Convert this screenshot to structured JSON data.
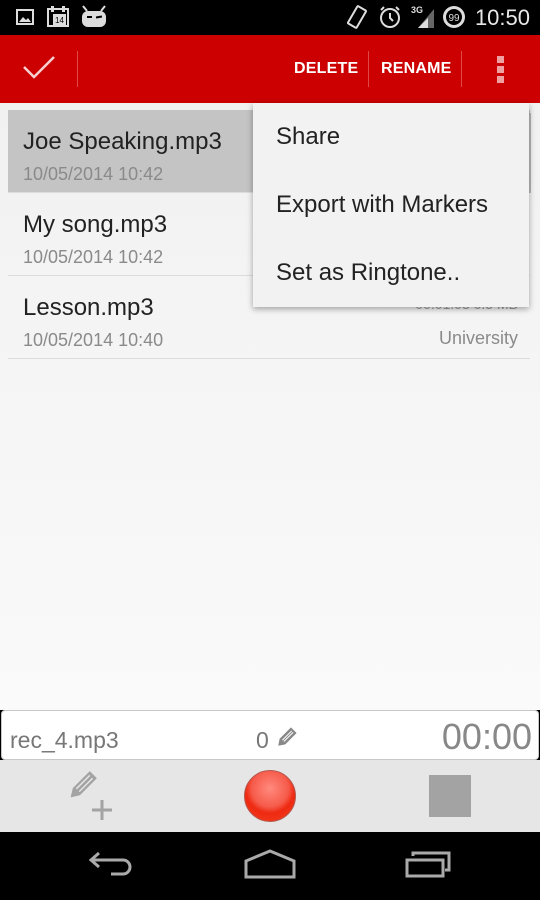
{
  "status_bar": {
    "icons": [
      "image-notification-icon",
      "calendar-notification-icon",
      "cyanogen-mascot-icon",
      "rotation-icon",
      "alarm-icon",
      "signal-3g-icon",
      "battery-icon"
    ],
    "calendar_day": "14",
    "network_label": "3G",
    "battery_level": "99",
    "time": "10:50"
  },
  "action_bar": {
    "done_icon": "checkmark-icon",
    "actions": [
      {
        "label": "DELETE"
      },
      {
        "label": "RENAME"
      }
    ],
    "overflow_icon": "overflow-menu-icon",
    "color": "#cc0000"
  },
  "recordings": [
    {
      "name": "Joe Speaking.mp3",
      "date": "10/05/2014 10:42",
      "meta": "",
      "tag": "",
      "selected": true
    },
    {
      "name": "My song.mp3",
      "date": "10/05/2014 10:42",
      "meta": "",
      "tag": "",
      "selected": false
    },
    {
      "name": "Lesson.mp3",
      "date": "10/05/2014 10:40",
      "meta": "00:01:03  0.5 MB",
      "tag": "University",
      "selected": false
    }
  ],
  "popup_menu": {
    "items": [
      {
        "label": "Share"
      },
      {
        "label": "Export with Markers"
      },
      {
        "label": "Set as Ringtone.."
      }
    ]
  },
  "recorder": {
    "filename": "rec_4.mp3",
    "marker_count": "0",
    "elapsed": "00:00",
    "controls": [
      "add-marker-icon",
      "record-icon",
      "stop-icon"
    ],
    "record_color": "#f0301a"
  },
  "nav_bar": {
    "buttons": [
      "back-icon",
      "home-icon",
      "recent-apps-icon"
    ]
  }
}
